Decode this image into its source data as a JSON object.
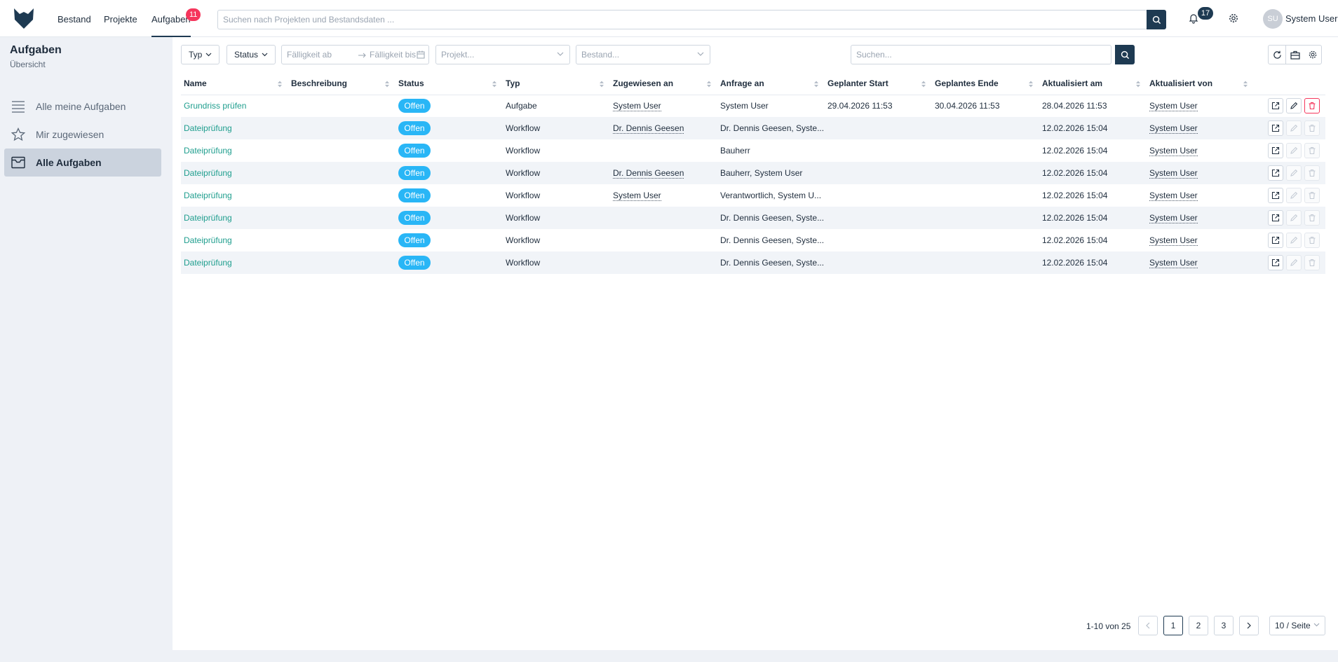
{
  "nav": {
    "items": [
      {
        "label": "Bestand"
      },
      {
        "label": "Projekte"
      },
      {
        "label": "Aufgaben",
        "badge": "11"
      }
    ],
    "search_placeholder": "Suchen nach Projekten und Bestandsdaten ...",
    "notifications_count": "17",
    "user_initials": "SU",
    "user_name": "System User"
  },
  "sidebar": {
    "title": "Aufgaben",
    "subtitle": "Übersicht",
    "items": [
      {
        "label": "Alle meine Aufgaben",
        "icon": "list-icon"
      },
      {
        "label": "Mir zugewiesen",
        "icon": "star-icon"
      },
      {
        "label": "Alle Aufgaben",
        "icon": "inbox-icon",
        "active": true
      }
    ]
  },
  "filters": {
    "type_label": "Typ",
    "status_label": "Status",
    "due_from_placeholder": "Fälligkeit ab",
    "due_to_placeholder": "Fälligkeit bis",
    "project_placeholder": "Projekt...",
    "inventory_placeholder": "Bestand...",
    "search_placeholder": "Suchen..."
  },
  "table": {
    "columns": [
      "Name",
      "Beschreibung",
      "Status",
      "Typ",
      "Zugewiesen an",
      "Anfrage an",
      "Geplanter Start",
      "Geplantes Ende",
      "Aktualisiert am",
      "Aktualisiert von"
    ],
    "rows": [
      {
        "name": "Grundriss prüfen",
        "description": "",
        "status": "Offen",
        "type": "Aufgabe",
        "assigned": "System User",
        "request": "System User",
        "start": "29.04.2026 11:53",
        "end": "30.04.2026 11:53",
        "updated_at": "28.04.2026 11:53",
        "updated_by": "System User",
        "editable": true
      },
      {
        "name": "Dateiprüfung",
        "description": "",
        "status": "Offen",
        "type": "Workflow",
        "assigned": "Dr. Dennis Geesen",
        "request": "Dr. Dennis Geesen, Syste...",
        "start": "",
        "end": "",
        "updated_at": "12.02.2026 15:04",
        "updated_by": "System User",
        "editable": false
      },
      {
        "name": "Dateiprüfung",
        "description": "",
        "status": "Offen",
        "type": "Workflow",
        "assigned": "",
        "request": "Bauherr",
        "start": "",
        "end": "",
        "updated_at": "12.02.2026 15:04",
        "updated_by": "System User",
        "editable": false
      },
      {
        "name": "Dateiprüfung",
        "description": "",
        "status": "Offen",
        "type": "Workflow",
        "assigned": "Dr. Dennis Geesen",
        "request": "Bauherr, System User",
        "start": "",
        "end": "",
        "updated_at": "12.02.2026 15:04",
        "updated_by": "System User",
        "editable": false
      },
      {
        "name": "Dateiprüfung",
        "description": "",
        "status": "Offen",
        "type": "Workflow",
        "assigned": "System User",
        "request": "Verantwortlich, System U...",
        "start": "",
        "end": "",
        "updated_at": "12.02.2026 15:04",
        "updated_by": "System User",
        "editable": false
      },
      {
        "name": "Dateiprüfung",
        "description": "",
        "status": "Offen",
        "type": "Workflow",
        "assigned": "",
        "request": "Dr. Dennis Geesen, Syste...",
        "start": "",
        "end": "",
        "updated_at": "12.02.2026 15:04",
        "updated_by": "System User",
        "editable": false
      },
      {
        "name": "Dateiprüfung",
        "description": "",
        "status": "Offen",
        "type": "Workflow",
        "assigned": "",
        "request": "Dr. Dennis Geesen, Syste...",
        "start": "",
        "end": "",
        "updated_at": "12.02.2026 15:04",
        "updated_by": "System User",
        "editable": false
      },
      {
        "name": "Dateiprüfung",
        "description": "",
        "status": "Offen",
        "type": "Workflow",
        "assigned": "",
        "request": "Dr. Dennis Geesen, Syste...",
        "start": "",
        "end": "",
        "updated_at": "12.02.2026 15:04",
        "updated_by": "System User",
        "editable": false
      }
    ]
  },
  "pagination": {
    "total_text": "1-10 von 25",
    "pages": [
      "1",
      "2",
      "3"
    ],
    "current": "1",
    "page_size": "10 / Seite"
  },
  "colors": {
    "brand": "#1e3a52",
    "link": "#1f9e8e",
    "status_open": "#29b6f6",
    "danger": "#f5365c"
  }
}
